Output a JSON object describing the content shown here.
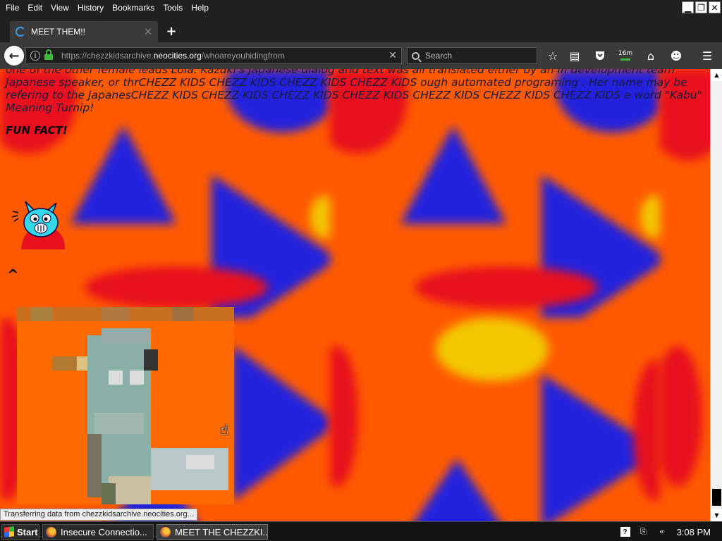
{
  "menubar": {
    "items": [
      "File",
      "Edit",
      "View",
      "History",
      "Bookmarks",
      "Tools",
      "Help"
    ]
  },
  "tab": {
    "title": "MEET THEM!!",
    "close_glyph": "×"
  },
  "new_tab_glyph": "+",
  "navbar": {
    "url_prefix": "https://chezzkidsarchive.",
    "url_domain": "neocities.org",
    "url_path": "/whoareyouhidingfrom",
    "search_placeholder": "Search",
    "timer_label": "16m"
  },
  "page": {
    "paragraph": "one of the other female leads Lola. Kazuki's Japanese dialog and text was all translated either by an in development team Japanese speaker, or thrCHEZZ KIDS CHEZZ KIDS CHEZZ KIDS CHEZZ KIDS ough automated programing . Her name may be refering to the JapanesCHEZZ KIDS CHEZZ KIDS CHEZZ KIDS CHEZZ KIDS CHEZZ KIDS CHEZZ KIDS CHEZZ KIDS e word \"Kabu\" Meaning Turnip!",
    "fun_fact": "FUN FACT!",
    "caret": "^"
  },
  "status_text": "Transferring data from chezzkidsarchive.neocities.org...",
  "taskbar": {
    "start_label": "Start",
    "tasks": [
      {
        "label": "Insecure Connectio..."
      },
      {
        "label": "MEET THE CHEZZKI..."
      }
    ],
    "clock": "3:08 PM"
  },
  "colors": {
    "page_orange": "#ff5a00",
    "triangle_blue": "#2222dd",
    "accent_red": "#e8101e",
    "accent_yellow": "#f2c800"
  },
  "icons": [
    "back-arrow-icon",
    "info-icon",
    "lock-icon",
    "clear-icon",
    "search-icon",
    "star-icon",
    "reading-list-icon",
    "pocket-icon",
    "timer-icon",
    "home-icon",
    "smiley-icon",
    "hamburger-menu-icon"
  ]
}
